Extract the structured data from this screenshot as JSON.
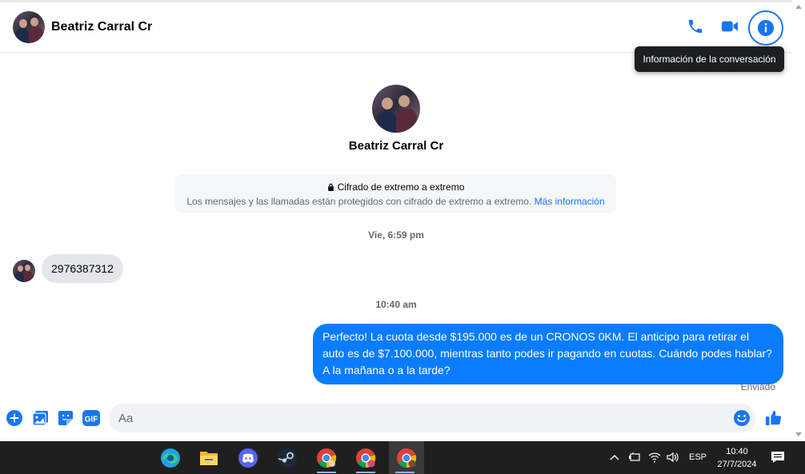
{
  "conversation": {
    "contact_name": "Beatriz Carral Cr",
    "tooltip": "Información de la conversación",
    "header_icons": [
      "phone-icon",
      "video-icon",
      "info-icon"
    ],
    "encryption": {
      "title": "Cifrado de extremo a extremo",
      "description": "Los mensajes y las llamadas están protegidos con cifrado de extremo a extremo.",
      "link": "Más información"
    },
    "timestamps": [
      "Vie, 6:59 pm",
      "10:40 am"
    ],
    "messages": [
      {
        "from": "contact",
        "text": "2976387312"
      },
      {
        "from": "me",
        "text": "Perfecto! La cuota desde $195.000 es de un CRONOS 0KM. El anticipo para retirar el auto es de $7.100.000, mientras tanto podes ir pagando en cuotas. Cuándo podes hablar? A la mañana o a la tarde?"
      }
    ],
    "sent_status": "Enviado"
  },
  "composer": {
    "placeholder": "Aa",
    "value": "",
    "icons": [
      "plus-icon",
      "photo-icon",
      "sticker-icon",
      "gif-icon",
      "emoji-icon",
      "like-icon"
    ],
    "gif_label": "GIF"
  },
  "taskbar": {
    "apps": [
      "edge-icon",
      "file-explorer-icon",
      "discord-icon",
      "steam-icon",
      "chrome-icon",
      "chrome-profile-icon",
      "chrome-profile-icon"
    ],
    "language": "ESP",
    "time": "10:40",
    "date": "27/7/2024"
  },
  "colors": {
    "accent": "#0a7cff",
    "icon_blue": "#1876f2",
    "bubble_in": "#e4e6eb",
    "taskbar": "#1f1f1f"
  }
}
